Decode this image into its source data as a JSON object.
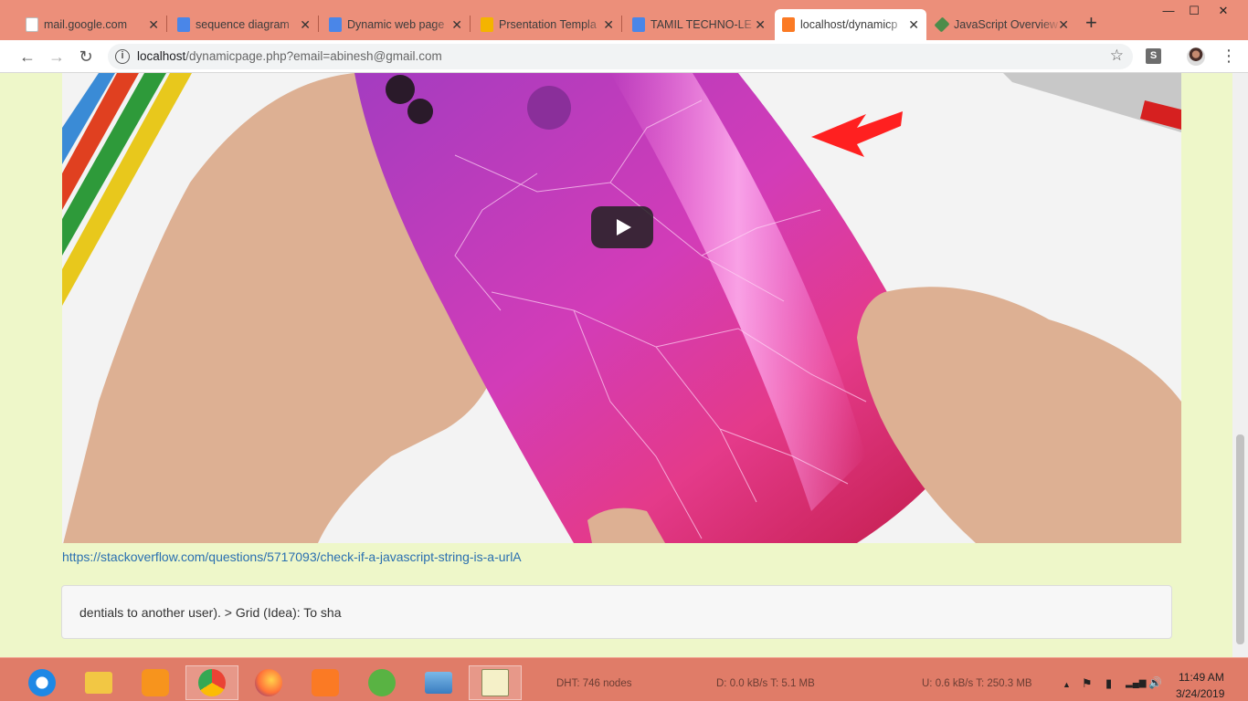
{
  "tabs": [
    {
      "label": "mail.google.com",
      "favicon_color": "#bdbdbd"
    },
    {
      "label": "sequence diagram",
      "favicon_color": "#4a86e8"
    },
    {
      "label": "Dynamic web page",
      "favicon_color": "#4a86e8"
    },
    {
      "label": "Prsentation Templa",
      "favicon_color": "#f4b400"
    },
    {
      "label": "TAMIL TECHNO-LE",
      "favicon_color": "#4a86e8"
    },
    {
      "label": "localhost/dynamicp",
      "favicon_color": "#fb7a24"
    },
    {
      "label": "JavaScript Overview",
      "favicon_color": "#4c8c4a"
    }
  ],
  "window": {
    "minimize": "—",
    "maximize": "☐",
    "close": "✕"
  },
  "newtab": "+",
  "tab_close": "✕",
  "toolbar": {
    "back": "←",
    "forward": "→",
    "reload": "↻",
    "info": "i",
    "url_host": "localhost",
    "url_path": "/dynamicpage.php?email=abinesh@gmail.com",
    "star": "☆",
    "extension_label": "S",
    "menu": "⋮"
  },
  "page": {
    "link_text": "https://stackoverflow.com/questions/5717093/check-if-a-javascript-string-is-a-urlA",
    "note_text": "dentials to another user). > Grid (Idea): To sha",
    "colors": {
      "background": "#eef7c9",
      "link": "#2a6fb0"
    }
  },
  "taskbar": {
    "dht": "DHT: 746 nodes",
    "download": "D: 0.0 kB/s T: 5.1 MB",
    "upload": "U: 0.6 kB/s T: 250.3 MB",
    "time": "11:49 AM",
    "date": "3/24/2019",
    "tray_up": "▲",
    "tray_flag": "⚑",
    "tray_network": "▮",
    "tray_signal": "▂▄▆",
    "tray_volume": "🔊"
  }
}
